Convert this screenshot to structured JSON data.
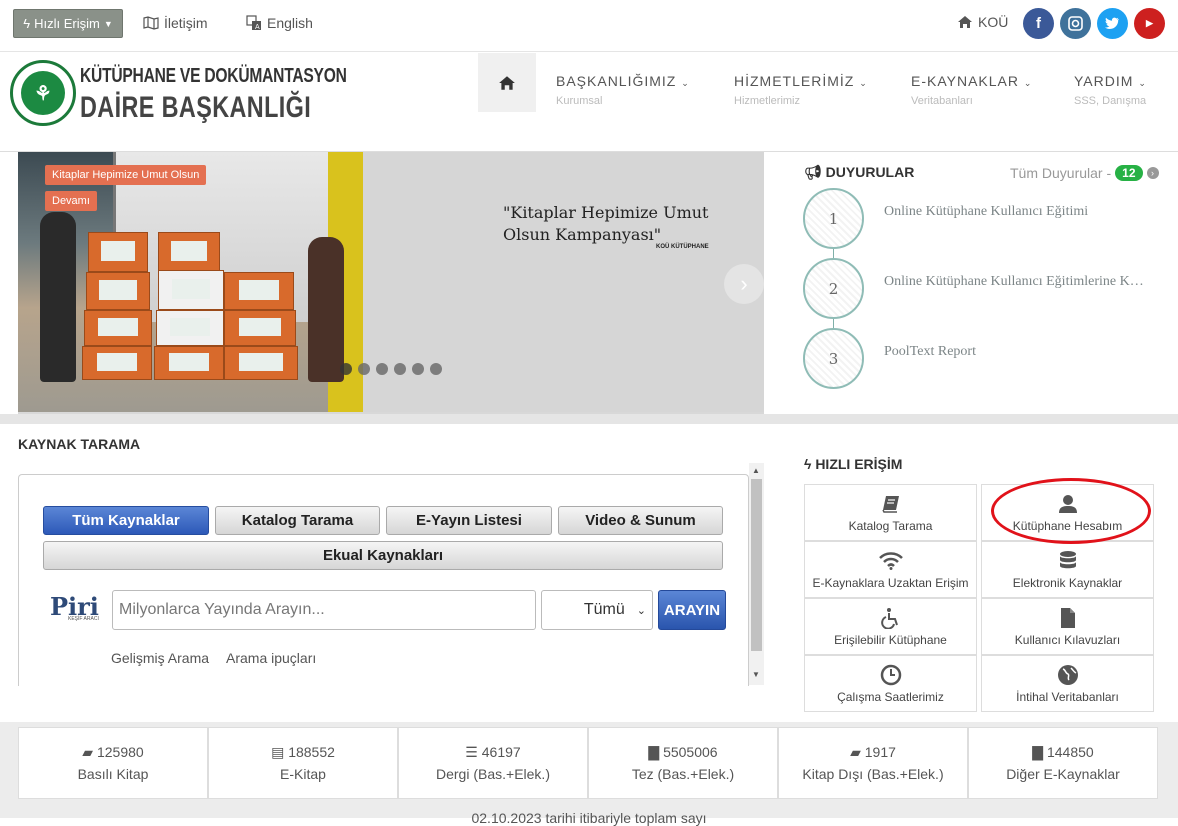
{
  "topbar": {
    "quick_access": "Hızlı Erişim",
    "contact": "İletişim",
    "language": "English",
    "kou": "KOÜ"
  },
  "header": {
    "logo_line1": "KÜTÜPHANE VE DOKÜMANTASYON",
    "logo_line2": "DAİRE BAŞKANLIĞI",
    "nav": [
      {
        "title": "BAŞKANLIĞIMIZ",
        "subtitle": "Kurumsal"
      },
      {
        "title": "HİZMETLERİMİZ",
        "subtitle": "Hizmetlerimiz"
      },
      {
        "title": "E-KAYNAKLAR",
        "subtitle": "Veritabanları"
      },
      {
        "title": "YARDIM",
        "subtitle": "SSS, Danışma"
      }
    ]
  },
  "slider": {
    "tag_title": "Kitaplar Hepimize Umut Olsun",
    "tag_more": "Devamı",
    "quote": "\"Kitaplar Hepimize Umut Olsun Kampanyası\"",
    "quote_sub": "KOÜ KÜTÜPHANE"
  },
  "announcements": {
    "title": "DUYURULAR",
    "all_label": "Tüm Duyurular -",
    "count": "12",
    "items": [
      {
        "num": "1",
        "text": "Online Kütüphane Kullanıcı Eğitimi"
      },
      {
        "num": "2",
        "text": "Online Kütüphane Kullanıcı Eğitimlerine Katılım"
      },
      {
        "num": "3",
        "text": "PoolText Report"
      }
    ]
  },
  "search": {
    "title": "KAYNAK TARAMA",
    "tabs": [
      "Tüm Kaynaklar",
      "Katalog Tarama",
      "E-Yayın Listesi",
      "Video & Sunum",
      "Ekual Kaynakları"
    ],
    "brand": "Piri",
    "brand_sub": "KEŞİF ARACI",
    "placeholder": "Milyonlarca Yayında Arayın...",
    "select_value": "Tümü",
    "button": "ARAYIN",
    "advanced": "Gelişmiş Arama",
    "tips": "Arama ipuçları"
  },
  "quick_access": {
    "title": "HIZLI ERİŞİM",
    "items": [
      {
        "label": "Katalog Tarama",
        "icon": "book-icon"
      },
      {
        "label": "Kütüphane Hesabım",
        "icon": "user-icon"
      },
      {
        "label": "E-Kaynaklara Uzaktan Erişim",
        "icon": "wifi-icon"
      },
      {
        "label": "Elektronik Kaynaklar",
        "icon": "database-icon"
      },
      {
        "label": "Erişilebilir Kütüphane",
        "icon": "wheelchair-icon"
      },
      {
        "label": "Kullanıcı Kılavuzları",
        "icon": "file-icon"
      },
      {
        "label": "Çalışma Saatlerimiz",
        "icon": "clock-icon"
      },
      {
        "label": "İntihal Veritabanları",
        "icon": "globe-icon"
      }
    ]
  },
  "stats": [
    {
      "value": "125980",
      "label": "Basılı Kitap"
    },
    {
      "value": "188552",
      "label": "E-Kitap"
    },
    {
      "value": "46197",
      "label": "Dergi (Bas.+Elek.)"
    },
    {
      "value": "5505006",
      "label": "Tez (Bas.+Elek.)"
    },
    {
      "value": "1917",
      "label": "Kitap Dışı (Bas.+Elek.)"
    },
    {
      "value": "144850",
      "label": "Diğer E-Kaynaklar"
    }
  ],
  "footnote": "02.10.2023 tarihi itibariyle toplam sayı",
  "colors": {
    "accent": "#2d59b8",
    "badge": "#27b145",
    "highlight": "#e1121a"
  }
}
